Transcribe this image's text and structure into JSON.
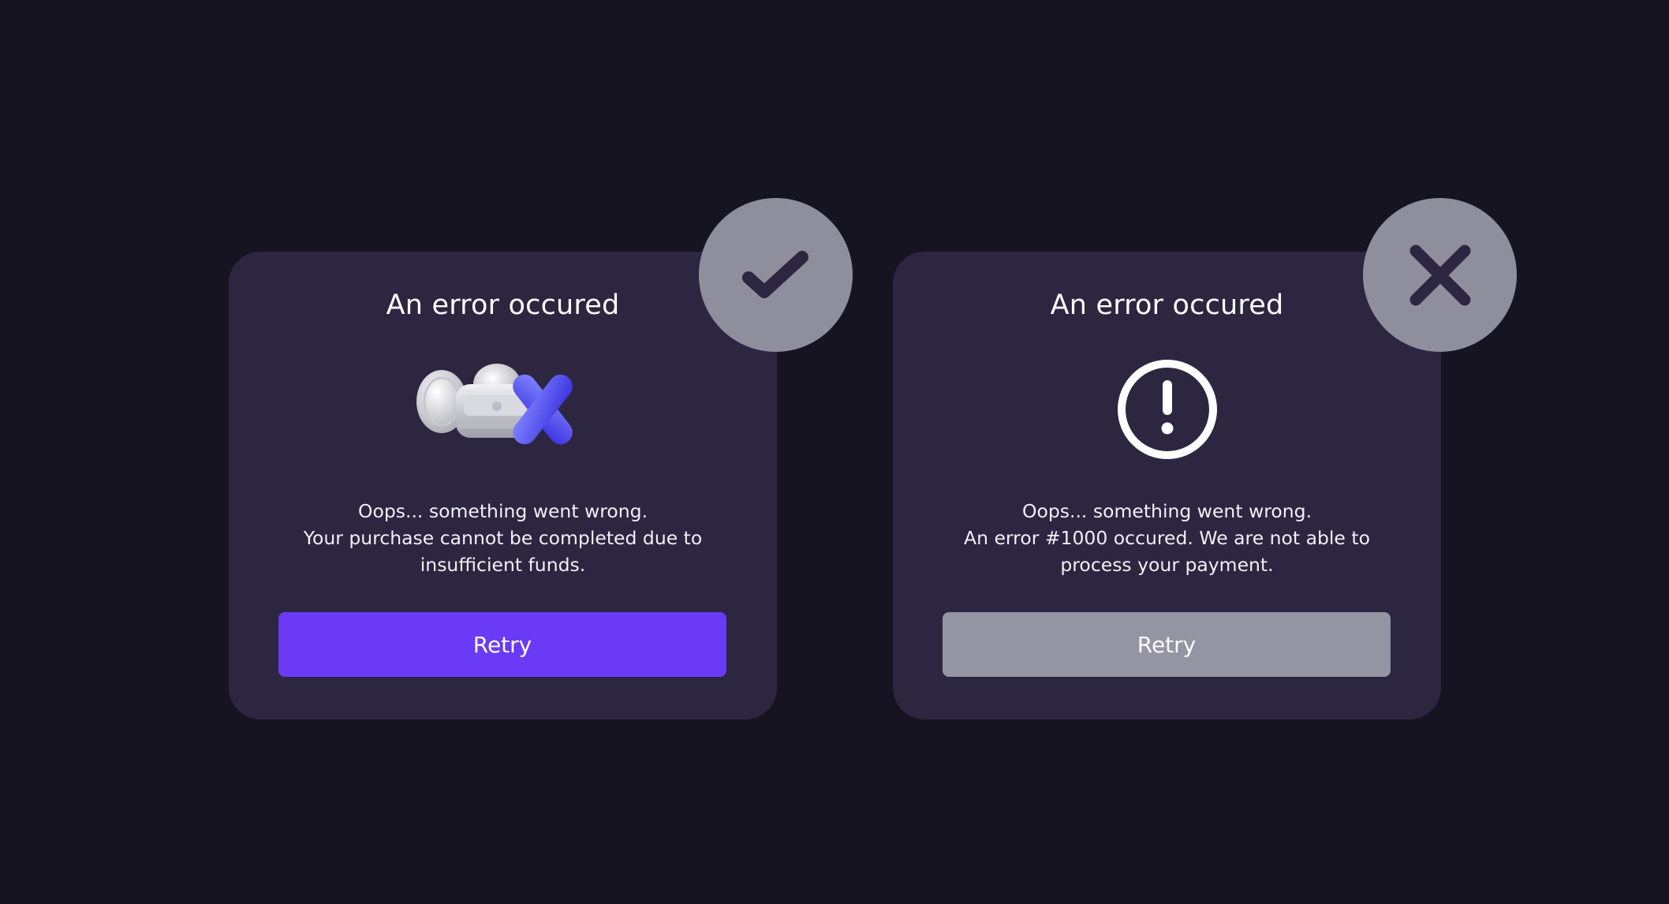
{
  "cards": [
    {
      "title": "An error occured",
      "message_lines": [
        "Oops... something went wrong.",
        "Your purchase cannot be completed due to",
        "insufficient funds."
      ],
      "button_label": "Retry",
      "button_color": "#6a3af7",
      "illustration": "wallet-coins-x-illustration",
      "badge_icon": "checkmark-icon",
      "verdict": "do"
    },
    {
      "title": "An error occured",
      "message_lines": [
        "Oops... something went wrong.",
        "An error #1000 occured. We are not able to",
        "process your payment."
      ],
      "button_label": "Retry",
      "button_color": "#9495a2",
      "illustration": "exclamation-circle-icon",
      "badge_icon": "cross-icon",
      "verdict": "don't"
    }
  ],
  "colors": {
    "background": "#171422",
    "card": "#2c2640",
    "badge": "#8f8e9d",
    "accent": "#6a3af7"
  }
}
